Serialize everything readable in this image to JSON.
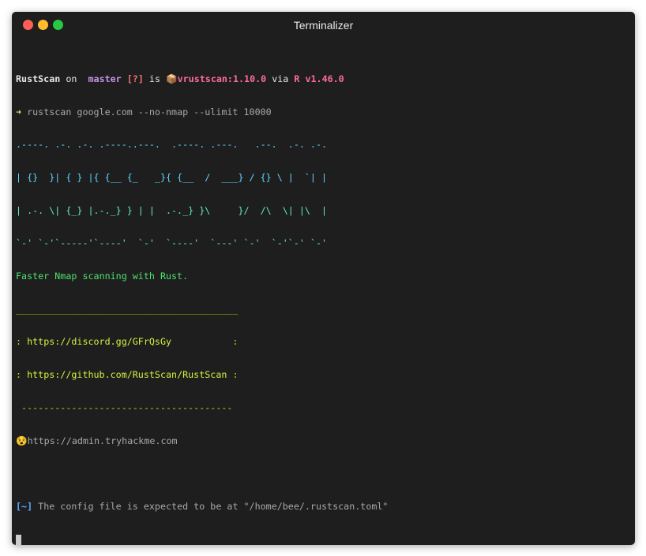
{
  "window": {
    "title": "Terminalizer"
  },
  "prompt": {
    "dir": "RustScan",
    "on": " on ",
    "branch_icon": "",
    "branch": " master ",
    "status": "[?]",
    "is": " is ",
    "pkg_icon": "📦",
    "pkg": "vrustscan:1.10.0",
    "via": " via ",
    "rust_icon": "R",
    "rust_version": " v1.46.0"
  },
  "command": {
    "arrow": "➜",
    "text": " rustscan google.com --no-nmap --ulimit 10000"
  },
  "banner": {
    "l1": ".----. .-. .-. .----..---.  .----. .---.   .--.  .-. .-.",
    "l2": "| {}  }| { } |{ {__ {_   _}{ {__  /  ___} / {} \\ |  `| |",
    "l3": "| .-. \\| {_} |.-._} } | |  .-._} }\\     }/  /\\  \\| |\\  |",
    "l4": "`-' `-'`-----'`----'  `-'  `----'  `---' `-'  `-'`-' `-'"
  },
  "tagline": "Faster Nmap scanning with Rust.",
  "links": {
    "top_rule": "________________________________________",
    "discord_prefix": ": ",
    "discord": "https://discord.gg/GFrQsGy",
    "discord_suffix": "           :",
    "github_prefix": ": ",
    "github": "https://github.com/RustScan/RustScan",
    "github_suffix": " :",
    "bottom_rule": " --------------------------------------"
  },
  "admin": {
    "icon": "😵",
    "url": "https://admin.tryhackme.com"
  },
  "config": {
    "prefix": "[~]",
    "message": " The config file is expected to be at \"/home/bee/.rustscan.toml\""
  }
}
